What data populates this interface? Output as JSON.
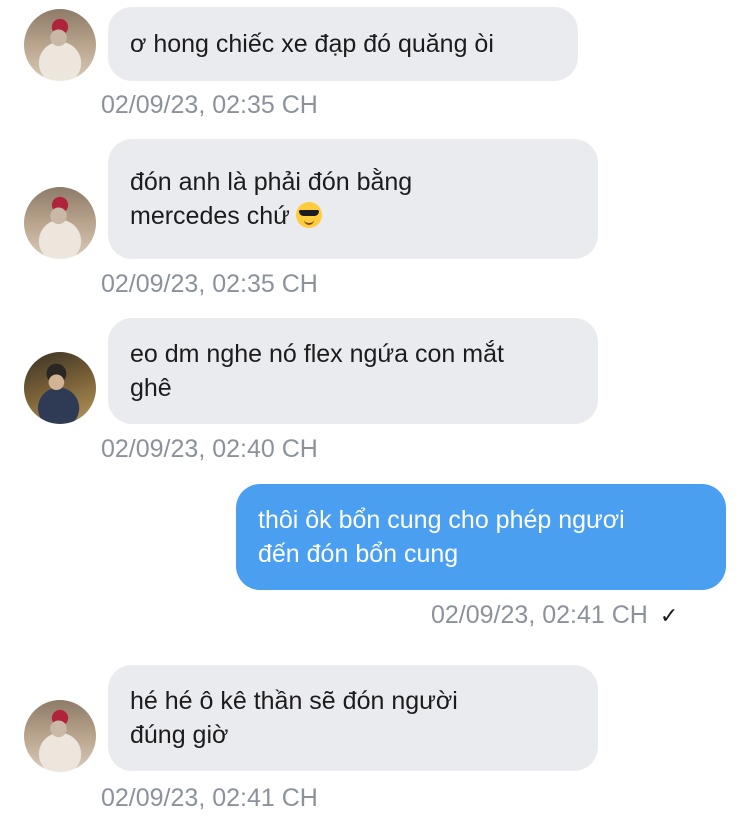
{
  "messages": [
    {
      "direction": "incoming",
      "avatar": "user-avatar-red-cap",
      "text": "ơ hong chiếc xe đạp đó quăng òi",
      "time": "02/09/23, 02:35 CH"
    },
    {
      "direction": "incoming",
      "avatar": "user-avatar-red-cap",
      "text": "đón anh là phải đón bằng\nmercedes chứ",
      "emoji": "smiling-face-with-sunglasses",
      "time": "02/09/23, 02:35 CH"
    },
    {
      "direction": "incoming",
      "avatar": "user-avatar-dark-jacket",
      "text": "eo dm nghe nó flex ngứa con mắt\nghê",
      "time": "02/09/23, 02:40 CH"
    },
    {
      "direction": "outgoing",
      "text": "thôi ôk bổn cung cho phép ngươi\nđến đón bổn cung",
      "time": "02/09/23, 02:41 CH",
      "status_icon": "checkmark-sent"
    },
    {
      "direction": "incoming",
      "avatar": "user-avatar-red-cap",
      "text": "hé hé ô kê thần sẽ đón người\nđúng giờ",
      "time": "02/09/23, 02:41 CH"
    }
  ],
  "colors": {
    "incoming_bubble": "#e9ebef",
    "outgoing_bubble": "#4a9ff0",
    "timestamp": "#8b929c"
  }
}
